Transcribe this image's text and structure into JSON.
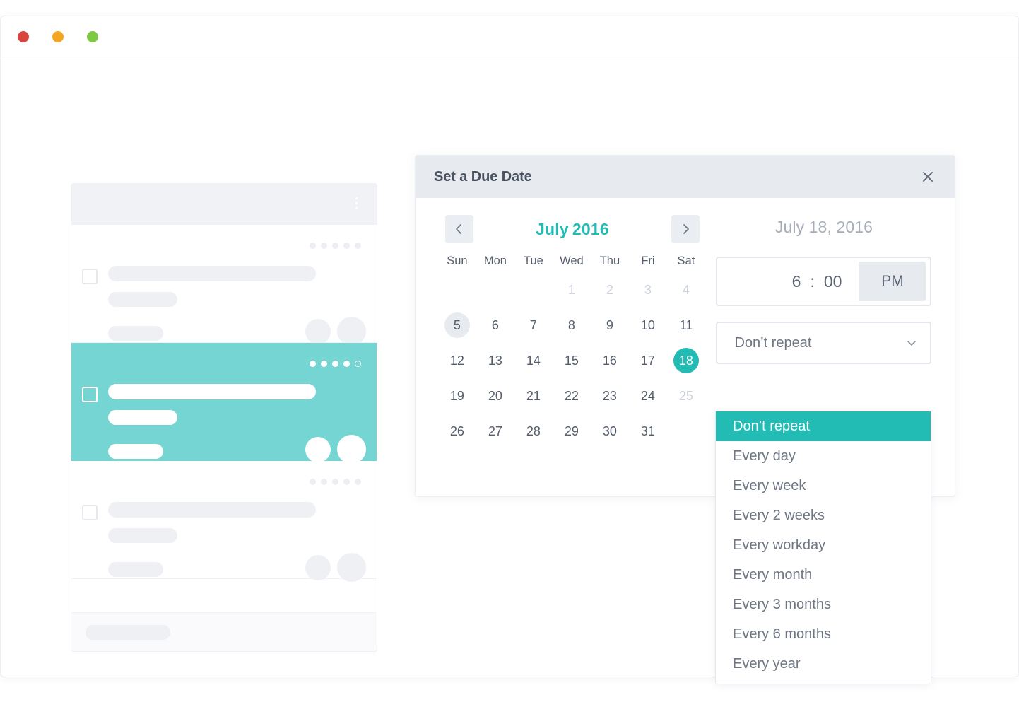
{
  "window": {
    "traffic_lights": [
      {
        "name": "close-button",
        "color": "#d9453c"
      },
      {
        "name": "minimize-button",
        "color": "#f4a623"
      },
      {
        "name": "maximize-button",
        "color": "#7ec943"
      }
    ]
  },
  "task_panel": {
    "kebab_icon": "more-vertical-icon",
    "cards": [
      {
        "selected": false,
        "pips": [
          "filled",
          "filled",
          "filled",
          "filled",
          "filled"
        ]
      },
      {
        "selected": true,
        "pips": [
          "filled",
          "filled",
          "filled",
          "filled",
          "hollow"
        ]
      },
      {
        "selected": false,
        "pips": [
          "filled",
          "filled",
          "filled",
          "filled",
          "filled"
        ]
      }
    ]
  },
  "modal": {
    "title": "Set a Due Date",
    "close_icon": "close-icon",
    "calendar": {
      "prev_icon": "chevron-left-icon",
      "next_icon": "chevron-right-icon",
      "month": "July",
      "year": "2016",
      "weekdays": [
        "Sun",
        "Mon",
        "Tue",
        "Wed",
        "Thu",
        "Fri",
        "Sat"
      ],
      "weeks": [
        [
          {
            "label": "",
            "state": "empty"
          },
          {
            "label": "",
            "state": "empty"
          },
          {
            "label": "",
            "state": "empty"
          },
          {
            "label": "1",
            "state": "muted"
          },
          {
            "label": "2",
            "state": "muted"
          },
          {
            "label": "3",
            "state": "muted"
          },
          {
            "label": "4",
            "state": "muted"
          }
        ],
        [
          {
            "label": "5",
            "state": "today"
          },
          {
            "label": "6",
            "state": "normal"
          },
          {
            "label": "7",
            "state": "normal"
          },
          {
            "label": "8",
            "state": "normal"
          },
          {
            "label": "9",
            "state": "normal"
          },
          {
            "label": "10",
            "state": "normal"
          },
          {
            "label": "11",
            "state": "normal"
          }
        ],
        [
          {
            "label": "12",
            "state": "normal"
          },
          {
            "label": "13",
            "state": "normal"
          },
          {
            "label": "14",
            "state": "normal"
          },
          {
            "label": "15",
            "state": "normal"
          },
          {
            "label": "16",
            "state": "normal"
          },
          {
            "label": "17",
            "state": "normal"
          },
          {
            "label": "18",
            "state": "selected"
          }
        ],
        [
          {
            "label": "19",
            "state": "normal"
          },
          {
            "label": "20",
            "state": "normal"
          },
          {
            "label": "21",
            "state": "normal"
          },
          {
            "label": "22",
            "state": "normal"
          },
          {
            "label": "23",
            "state": "normal"
          },
          {
            "label": "24",
            "state": "normal"
          },
          {
            "label": "25",
            "state": "muted"
          }
        ],
        [
          {
            "label": "26",
            "state": "normal"
          },
          {
            "label": "27",
            "state": "normal"
          },
          {
            "label": "28",
            "state": "normal"
          },
          {
            "label": "29",
            "state": "normal"
          },
          {
            "label": "30",
            "state": "normal"
          },
          {
            "label": "31",
            "state": "normal"
          },
          {
            "label": "",
            "state": "empty"
          }
        ]
      ]
    },
    "selected_date_label": "July 18, 2016",
    "time": {
      "hour": "6",
      "separator": ":",
      "minute": "00",
      "meridiem": "PM"
    },
    "repeat": {
      "selected": "Don’t repeat",
      "chevron_icon": "chevron-down-icon",
      "options": [
        "Don’t repeat",
        "Every day",
        "Every week",
        "Every 2 weeks",
        "Every workday",
        "Every month",
        "Every 3 months",
        "Every 6 months",
        "Every year"
      ],
      "active_index": 0
    }
  },
  "colors": {
    "accent_teal": "#22bcb5",
    "card_teal": "#75d5d3",
    "header_gray": "#e7eaef",
    "skeleton_gray": "#eff0f4",
    "text_slate": "#555e6c",
    "muted_gray": "#ccd1da"
  }
}
